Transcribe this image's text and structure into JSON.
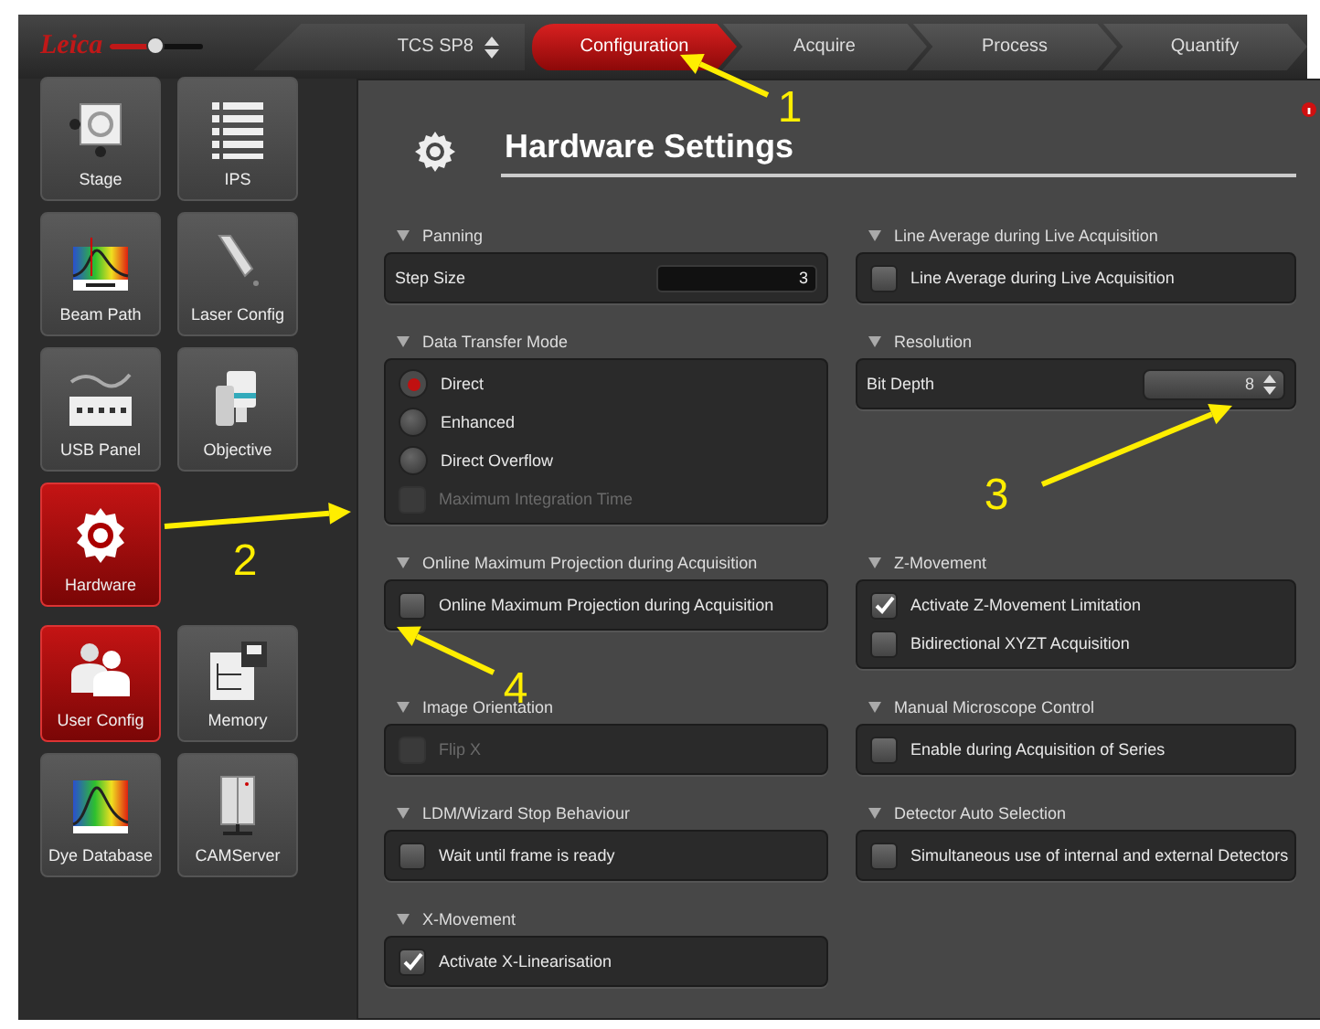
{
  "top_bar": {
    "logo": "Leica",
    "zoom_slider": {
      "level": 0.5
    },
    "device": "TCS SP8",
    "tabs": [
      {
        "label": "Configuration",
        "selected": true
      },
      {
        "label": "Acquire",
        "selected": false
      },
      {
        "label": "Process",
        "selected": false
      },
      {
        "label": "Quantify",
        "selected": false
      }
    ]
  },
  "sidebar": {
    "tiles": [
      {
        "label": "Stage",
        "selected": false
      },
      {
        "label": "IPS",
        "selected": false
      },
      {
        "label": "Beam Path",
        "selected": false
      },
      {
        "label": "Laser Config",
        "selected": false
      },
      {
        "label": "USB Panel",
        "selected": false
      },
      {
        "label": "Objective",
        "selected": false
      },
      {
        "label": "Hardware",
        "selected": true
      },
      {
        "label": "User Config",
        "selected": true
      },
      {
        "label": "Memory",
        "selected": false
      },
      {
        "label": "Dye Database",
        "selected": false
      },
      {
        "label": "CAMServer",
        "selected": false
      }
    ]
  },
  "panel": {
    "title": "Hardware Settings",
    "sections": [
      {
        "title": "Panning",
        "controls": [
          {
            "kind": "number",
            "label": "Step Size",
            "value": "3"
          }
        ]
      },
      {
        "title": "Line Average during Live Acquisition",
        "controls": [
          {
            "kind": "checkbox",
            "label": "Line Average during Live Acquisition",
            "checked": false,
            "disabled": false
          }
        ]
      },
      {
        "title": "Data Transfer Mode",
        "controls": [
          {
            "kind": "radio",
            "label": "Direct",
            "selected": true
          },
          {
            "kind": "radio",
            "label": "Enhanced",
            "selected": false
          },
          {
            "kind": "radio",
            "label": "Direct Overflow",
            "selected": false
          },
          {
            "kind": "checkbox",
            "label": "Maximum Integration Time",
            "checked": false,
            "disabled": true
          }
        ]
      },
      {
        "title": "Resolution",
        "controls": [
          {
            "kind": "spinner",
            "label": "Bit Depth",
            "value": "8"
          }
        ]
      },
      {
        "title": "Online Maximum Projection during Acquisition",
        "controls": [
          {
            "kind": "checkbox",
            "label": "Online Maximum Projection during Acquisition",
            "checked": false,
            "disabled": false
          }
        ]
      },
      {
        "title": "Z-Movement",
        "controls": [
          {
            "kind": "checkbox",
            "label": "Activate Z-Movement Limitation",
            "checked": true,
            "disabled": false
          },
          {
            "kind": "checkbox",
            "label": "Bidirectional XYZT Acquisition",
            "checked": false,
            "disabled": false
          }
        ]
      },
      {
        "title": "Image Orientation",
        "controls": [
          {
            "kind": "checkbox",
            "label": "Flip X",
            "checked": false,
            "disabled": true
          }
        ]
      },
      {
        "title": "Manual Microscope Control",
        "controls": [
          {
            "kind": "checkbox",
            "label": "Enable during Acquisition of Series",
            "checked": false,
            "disabled": false
          }
        ]
      },
      {
        "title": "LDM/Wizard Stop Behaviour",
        "controls": [
          {
            "kind": "checkbox",
            "label": "Wait until frame is ready",
            "checked": false,
            "disabled": false
          }
        ]
      },
      {
        "title": "Detector Auto Selection",
        "controls": [
          {
            "kind": "checkbox",
            "label": "Simultaneous use of internal and external Detectors",
            "checked": false,
            "disabled": false
          }
        ]
      },
      {
        "title": "X-Movement",
        "controls": [
          {
            "kind": "checkbox",
            "label": "Activate X-Linearisation",
            "checked": true,
            "disabled": false
          }
        ]
      }
    ]
  },
  "annotations": [
    {
      "label": "1"
    },
    {
      "label": "2"
    },
    {
      "label": "3"
    },
    {
      "label": "4"
    }
  ]
}
